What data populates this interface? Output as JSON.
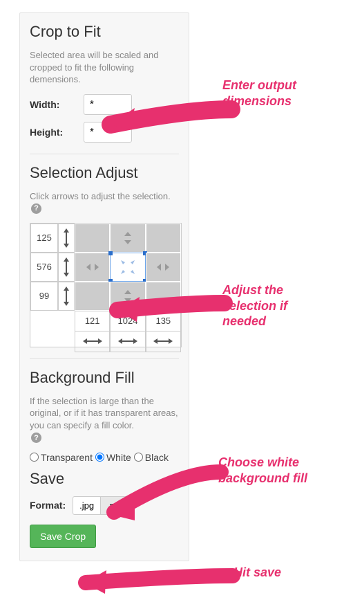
{
  "crop": {
    "title": "Crop to Fit",
    "desc": "Selected area will be scaled and cropped to fit the following demensions.",
    "width_label": "Width:",
    "width_value": "*",
    "height_label": "Height:",
    "height_value": "*"
  },
  "adjust": {
    "title": "Selection Adjust",
    "desc": "Click arrows to adjust the selection.",
    "rows": [
      "125",
      "576",
      "99"
    ],
    "cols": [
      "121",
      "1024",
      "135"
    ]
  },
  "bgfill": {
    "title": "Background Fill",
    "desc": "If the selection is large than the original, or if it has transparent areas, you can specify a fill color.",
    "options": {
      "transparent": "Transparent",
      "white": "White",
      "black": "Black"
    },
    "selected": "white"
  },
  "save": {
    "title": "Save",
    "format_label": "Format:",
    "formats": {
      "jpg": ".jpg",
      "png": ".png"
    },
    "button": "Save Crop"
  },
  "annotations": {
    "dims": "Enter output\ndimensions",
    "adjust": "Adjust the\nselection if\nneeded",
    "bg": "Choose white\nbackground fill",
    "save": "Hit save"
  }
}
